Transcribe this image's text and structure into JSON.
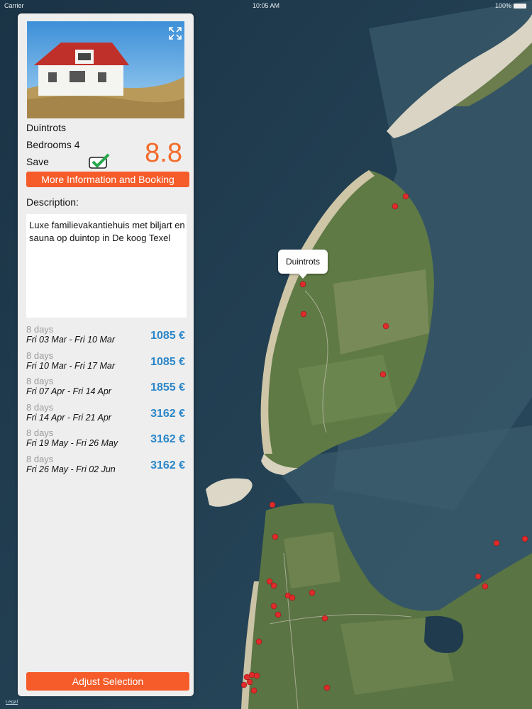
{
  "status": {
    "carrier": "Carrier",
    "time": "10:05 AM",
    "battery": "100%"
  },
  "map": {
    "legal": "Legal",
    "callout": "Duintrots"
  },
  "listing": {
    "name": "Duintrots",
    "bedrooms": "Bedrooms 4",
    "save_label": "Save",
    "saved": true,
    "rating": "8.8",
    "more_button": "More Information and Booking",
    "description_label": "Description:",
    "description": "Luxe familievakantiehuis met biljart en sauna op duintop in De koog Texel",
    "offers": [
      {
        "days": "8 days",
        "dates": "Fri 03 Mar - Fri 10 Mar",
        "price": "1085 €"
      },
      {
        "days": "8 days",
        "dates": "Fri 10 Mar - Fri 17 Mar",
        "price": "1085 €"
      },
      {
        "days": "8 days",
        "dates": "Fri 07 Apr - Fri 14 Apr",
        "price": "1855 €"
      },
      {
        "days": "8 days",
        "dates": "Fri 14 Apr - Fri 21 Apr",
        "price": "3162 €"
      },
      {
        "days": "8 days",
        "dates": "Fri 19 May - Fri 26 May",
        "price": "3162 €"
      },
      {
        "days": "8 days",
        "dates": "Fri 26 May - Fri 02 Jun",
        "price": "3162 €"
      }
    ],
    "adjust_button": "Adjust Selection"
  },
  "colors": {
    "accent": "#f55c2a",
    "rating": "#f36b2c",
    "price": "#2a86c8",
    "water": "#1e3a4e"
  }
}
